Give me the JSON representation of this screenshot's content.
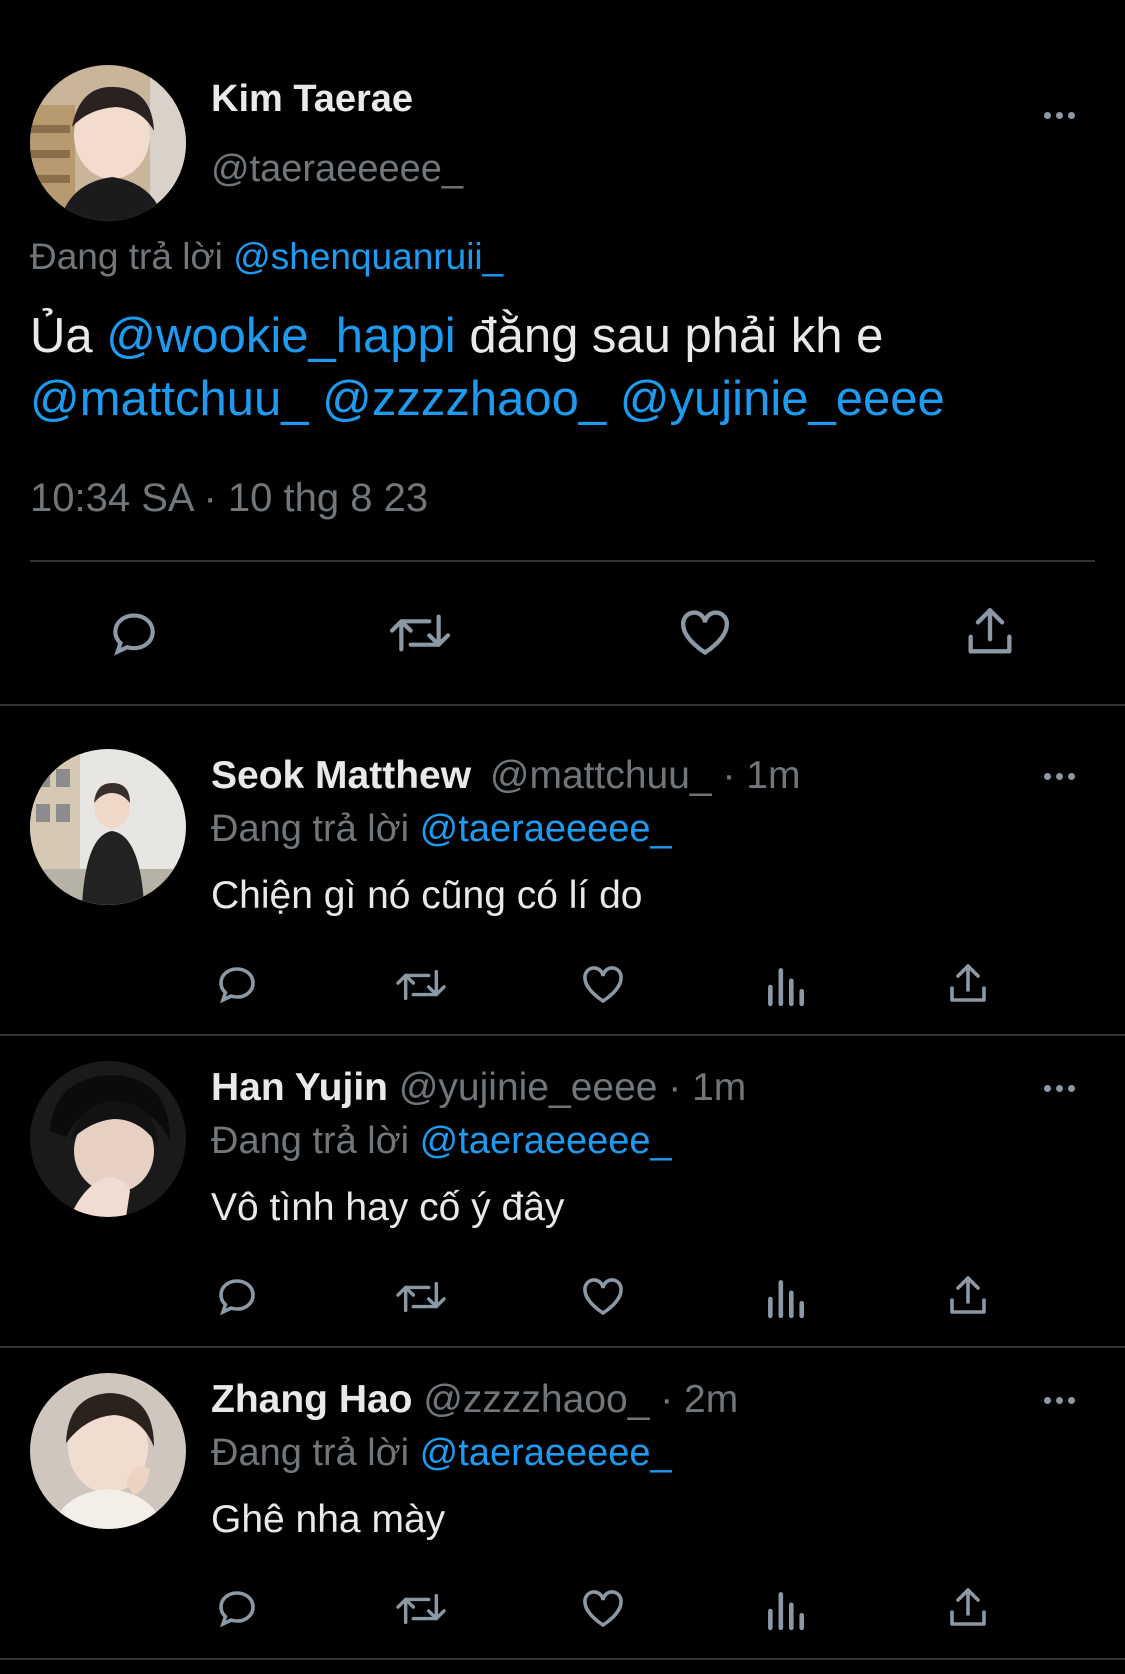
{
  "main_tweet": {
    "author_name": "Kim Taerae",
    "author_handle": "@taeraeeeee_",
    "reply_prefix": "Đang trả lời",
    "reply_to": "@shenquanruii_",
    "text_prefix": "Ủa",
    "mention_1": "@wookie_happi",
    "text_middle": "đằng sau phải kh e",
    "mention_2": "@mattchuu_",
    "mention_3": "@zzzzhaoo_",
    "mention_4": "@yujinie_eeee",
    "timestamp": "10:34 SA · 10 thg 8 23"
  },
  "replies": [
    {
      "author_name": "Seok Matthew",
      "author_handle": "@mattchuu_",
      "age": "· 1m",
      "reply_prefix": "Đang trả lời",
      "reply_to": "@taeraeeeee_",
      "text": "Chiện gì nó cũng có lí do"
    },
    {
      "author_name": "Han Yujin",
      "author_handle": "@yujinie_eeee",
      "age": "· 1m",
      "reply_prefix": "Đang trả lời",
      "reply_to": "@taeraeeeee_",
      "text": "Vô tình hay cố ý đây"
    },
    {
      "author_name": "Zhang Hao",
      "author_handle": "@zzzzhaoo_",
      "age": "· 2m",
      "reply_prefix": "Đang trả lời",
      "reply_to": "@taeraeeeee_",
      "text": "Ghê nha mày"
    }
  ],
  "icons": {
    "reply": "speech-bubble",
    "retweet": "retweet-arrows",
    "like": "heart",
    "views": "bar-chart",
    "share": "upload-arrow",
    "more": "three-dots"
  },
  "colors": {
    "background": "#000000",
    "link": "#1d9bf0",
    "muted": "#71767b",
    "text": "#e7e9ea"
  }
}
